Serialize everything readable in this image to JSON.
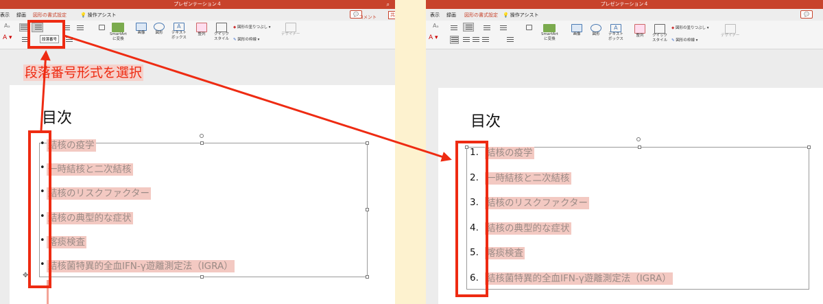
{
  "app": {
    "window_title": "プレゼンテーション４",
    "menu": [
      "表示",
      "録画",
      "図形の書式設定"
    ],
    "assist": "操作アシスト",
    "comment_button": "コメント",
    "share_partial": "共",
    "accent_color": "#c8432c",
    "annotation_color": "#ee2b12"
  },
  "ribbon": {
    "numbering_tooltip": "段落番号",
    "smartart": [
      "SmartArt",
      "に変換"
    ],
    "image": "画像",
    "shape": "図形",
    "textbox": [
      "テキスト",
      "ボックス"
    ],
    "arrange": "整列",
    "quick_style": [
      "クイック",
      "スタイル"
    ],
    "shape_fill": "図形の塗りつぶし",
    "shape_outline": "図形の枠線",
    "designer": "デザイナー"
  },
  "slide": {
    "title": "目次",
    "items": [
      "結核の疫学",
      "一時結核と二次結核",
      "結核のリスクファクター",
      "結核の典型的な症状",
      "喀痰検査",
      "結核菌特異的全血IFN-γ遊離測定法（IGRA）"
    ],
    "bullet_symbol": "•",
    "numbers": [
      "1.",
      "2.",
      "3.",
      "4.",
      "5.",
      "6."
    ]
  },
  "annotation": {
    "label": "段落番号形式を選択"
  }
}
